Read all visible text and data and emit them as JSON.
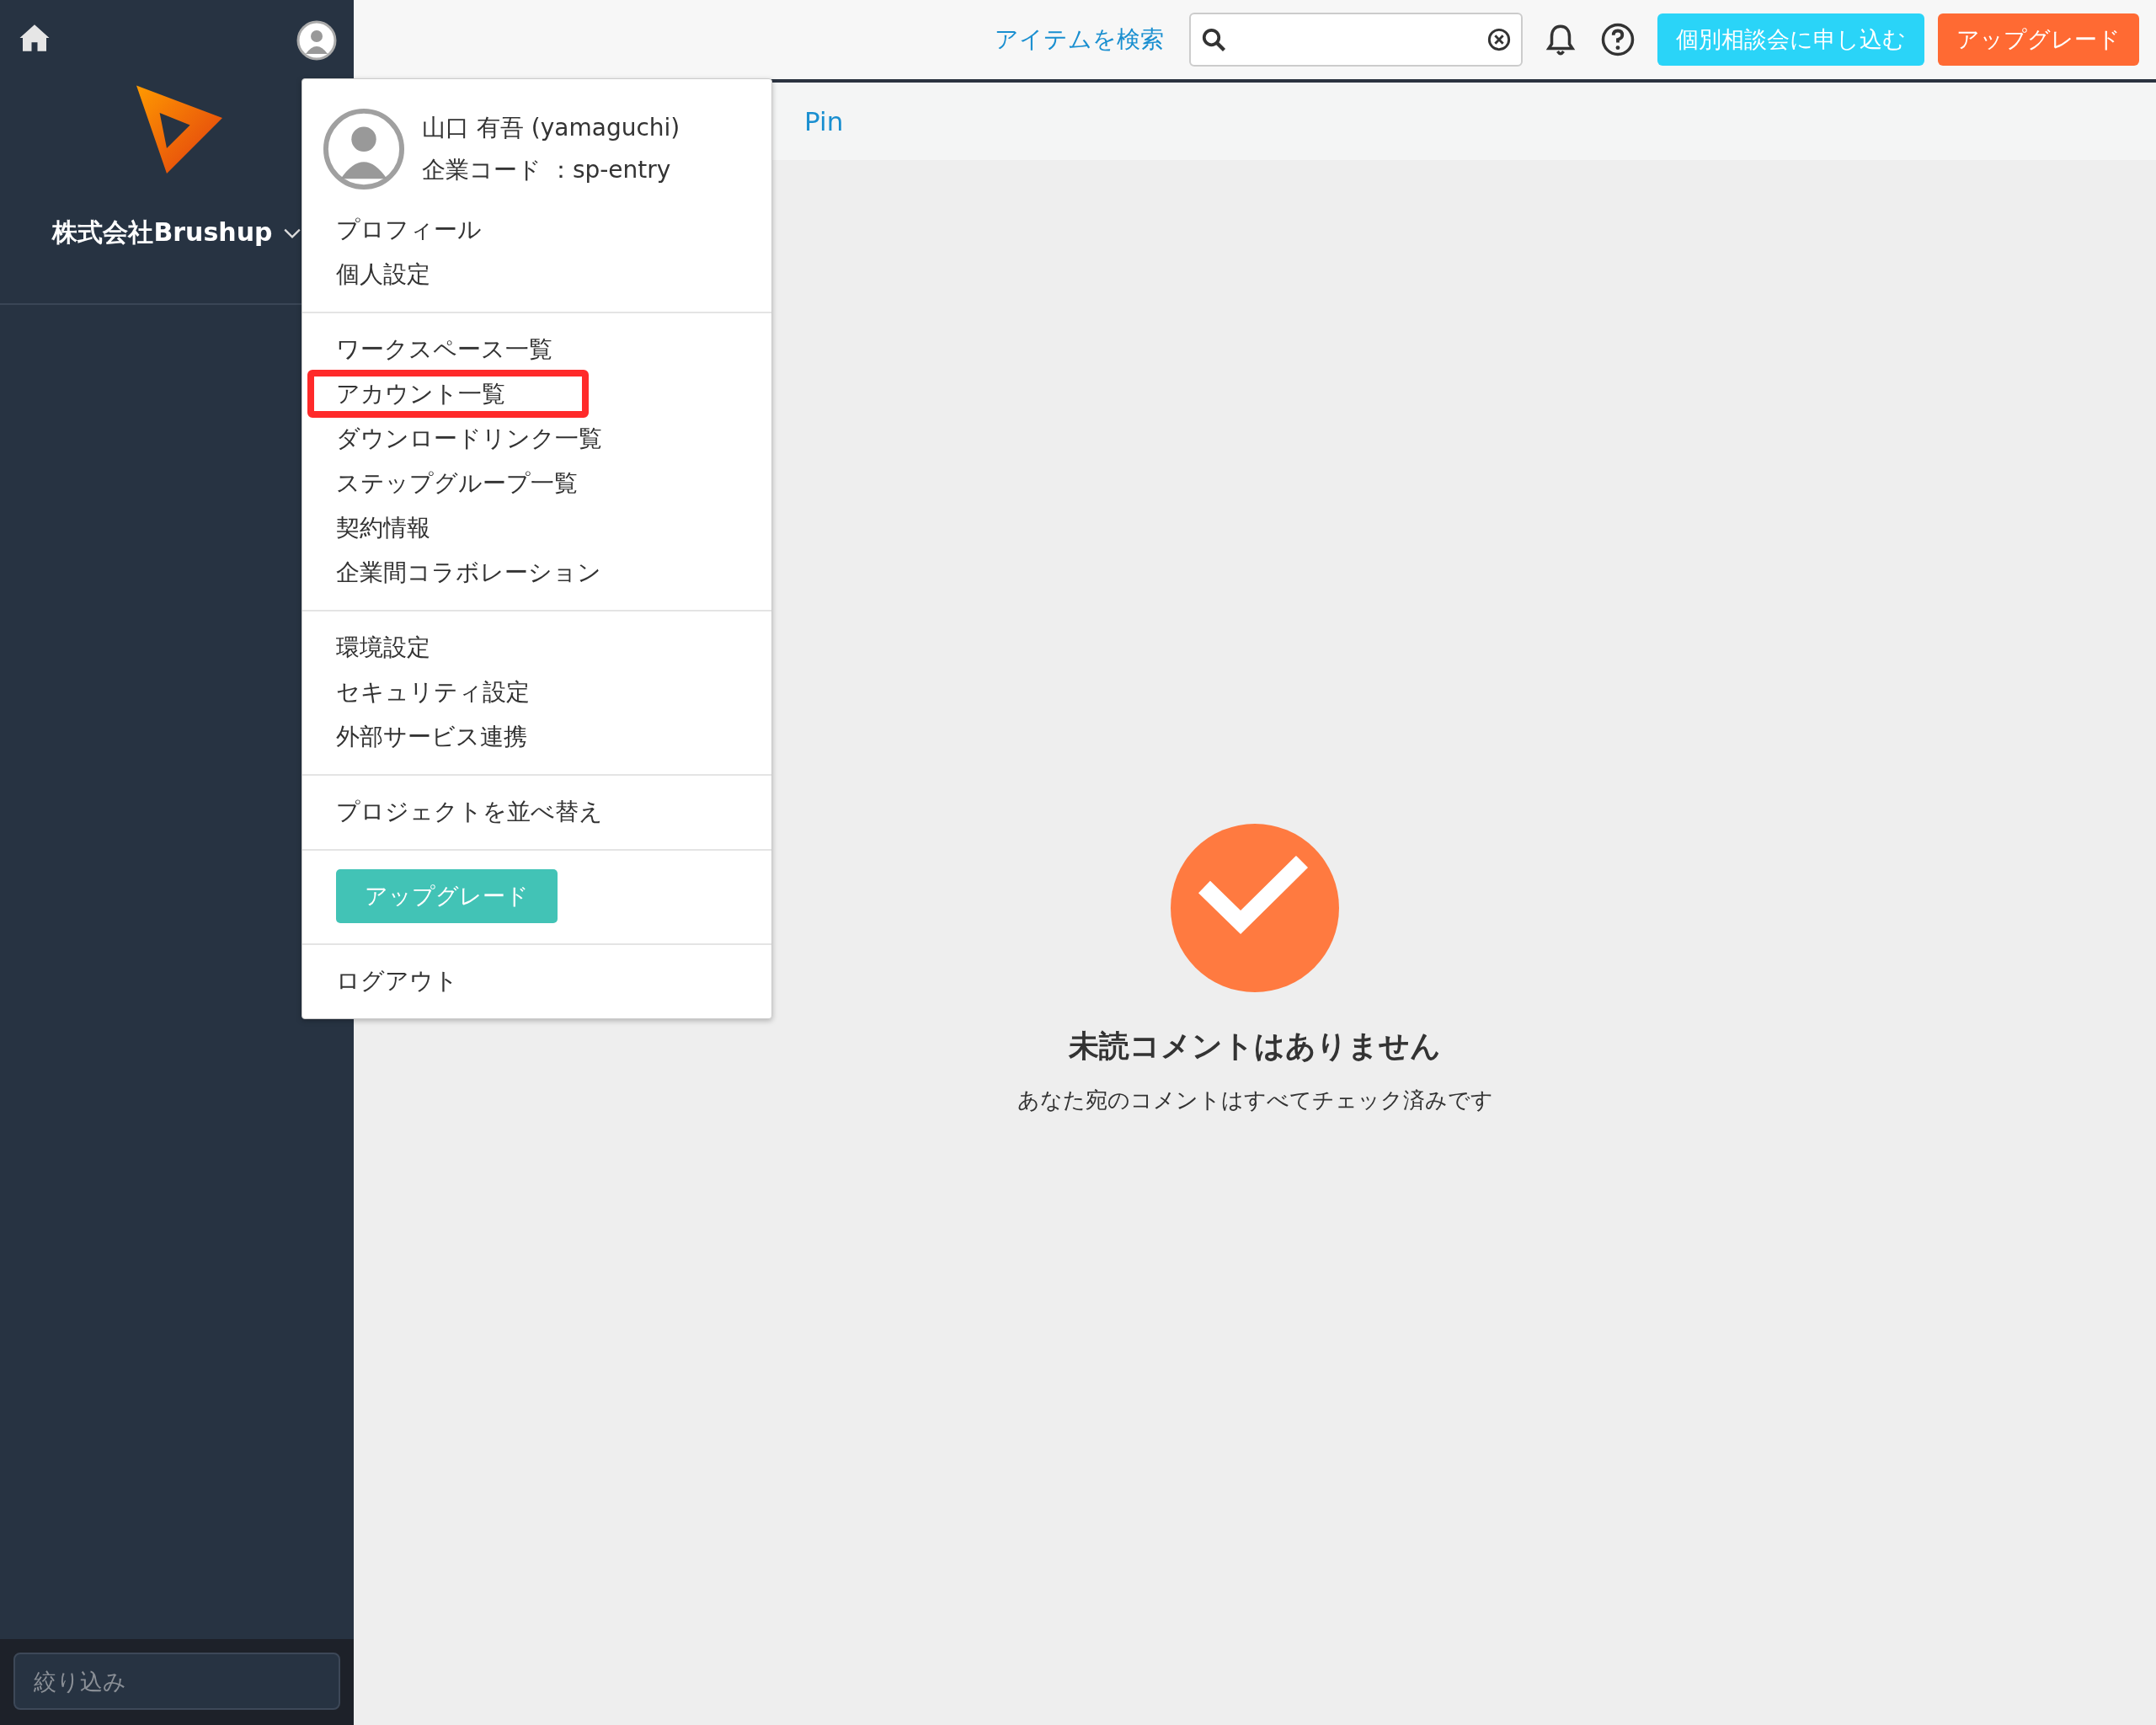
{
  "sidebar": {
    "company": "株式会社Brushup",
    "filter": {
      "placeholder": "絞り込み"
    }
  },
  "header": {
    "search_label": "アイテムを検索",
    "consult_button": "個別相談会に申し込む",
    "upgrade_button": "アップグレード"
  },
  "tabs": [
    {
      "label": "Pin",
      "selected": true
    }
  ],
  "user_menu": {
    "name": "山口 有吾 (yamaguchi)",
    "company_code": "企業コード ：sp-entry",
    "sections": [
      {
        "items": [
          {
            "label": "プロフィール",
            "highlighted": false
          },
          {
            "label": "個人設定",
            "highlighted": false
          }
        ]
      },
      {
        "items": [
          {
            "label": "ワークスペース一覧",
            "highlighted": false
          },
          {
            "label": "アカウント一覧",
            "highlighted": true
          },
          {
            "label": "ダウンロードリンク一覧",
            "highlighted": false
          },
          {
            "label": "ステップグループ一覧",
            "highlighted": false
          },
          {
            "label": "契約情報",
            "highlighted": false
          },
          {
            "label": "企業間コラボレーション",
            "highlighted": false
          }
        ]
      },
      {
        "items": [
          {
            "label": "環境設定",
            "highlighted": false
          },
          {
            "label": "セキュリティ設定",
            "highlighted": false
          },
          {
            "label": "外部サービス連携",
            "highlighted": false
          }
        ]
      },
      {
        "items": [
          {
            "label": "プロジェクトを並べ替え",
            "highlighted": false
          }
        ]
      }
    ],
    "upgrade_button": "アップグレード",
    "logout": "ログアウト"
  },
  "empty_state": {
    "title": "未読コメントはありません",
    "message": "あなた宛のコメントはすべてチェック済みです"
  }
}
